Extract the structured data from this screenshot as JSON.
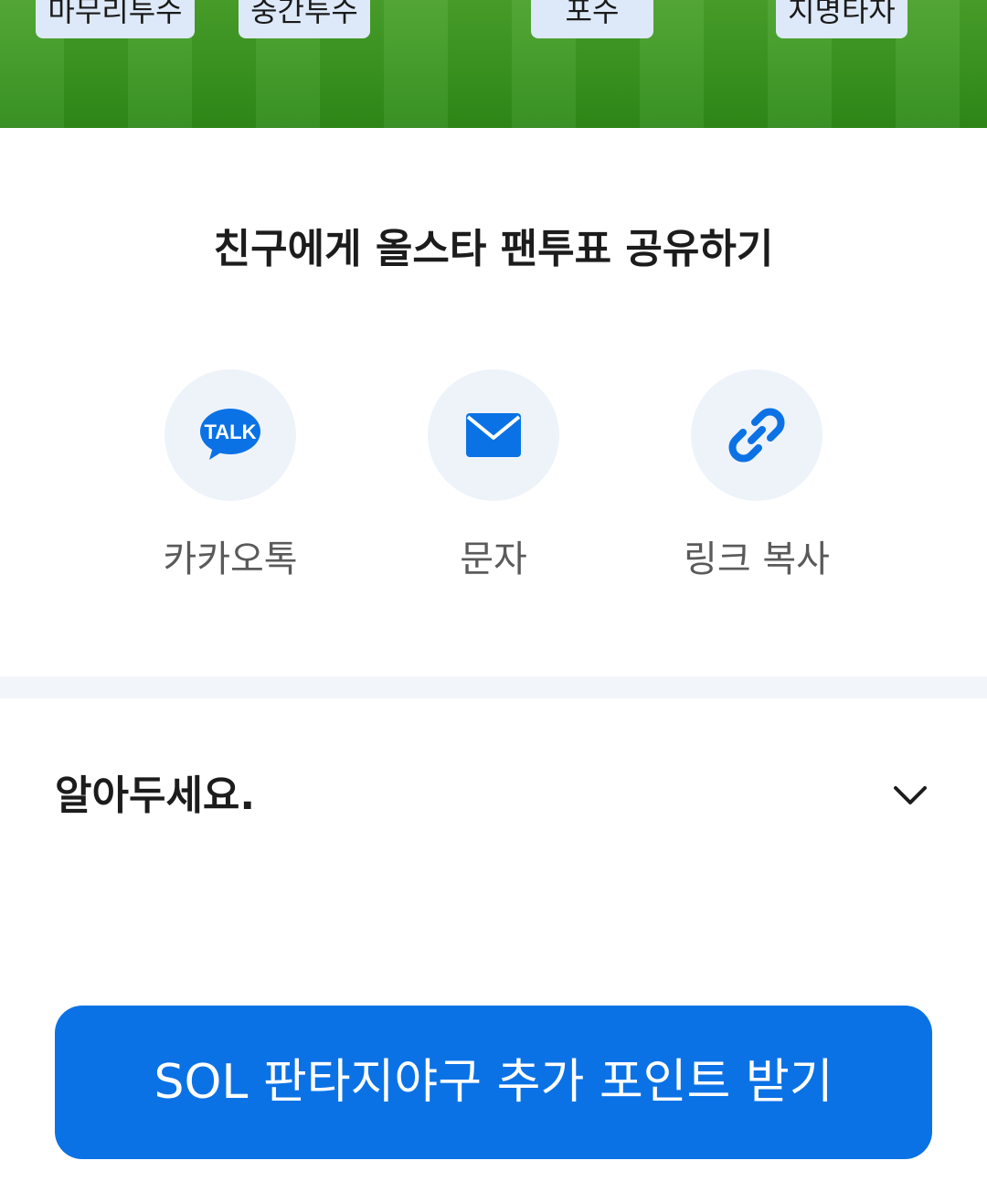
{
  "field": {
    "positions": [
      "마무리투수",
      "중간투수",
      "포수",
      "지명타자"
    ]
  },
  "share": {
    "title": "친구에게 올스타 팬투표 공유하기",
    "kakao": {
      "label": "카카오톡",
      "icon_text": "TALK",
      "icon": "kakao-talk-icon"
    },
    "sms": {
      "label": "문자",
      "icon": "envelope-icon"
    },
    "link": {
      "label": "링크 복사",
      "icon": "link-icon"
    }
  },
  "notice": {
    "title": "알아두세요.",
    "icon": "chevron-down-icon"
  },
  "cta": {
    "label": "SOL 판타지야구 추가 포인트 받기"
  },
  "colors": {
    "accent": "#0b72e6",
    "field_green": "#3a9620",
    "chip_bg": "#dde9f8",
    "icon_circle_bg": "#eef3fa",
    "divider": "#f2f5f9"
  }
}
